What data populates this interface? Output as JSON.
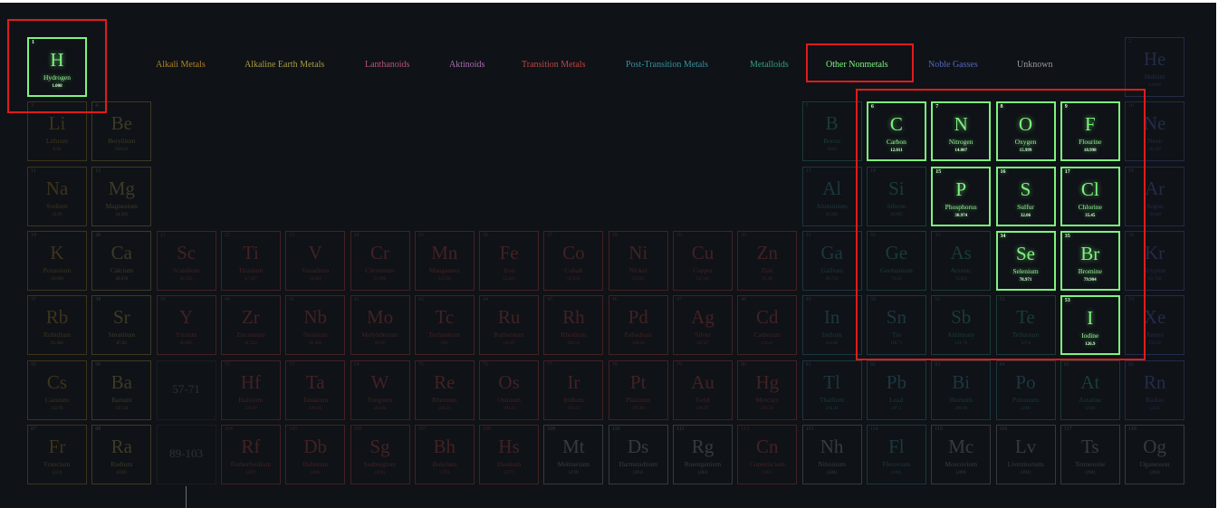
{
  "colors": {
    "background": "#0f1217",
    "highlight_red": "#e01b1b",
    "active_green": "#7ef37e",
    "categories": {
      "alkali": "#c9962a",
      "alkaline": "#c1b34b",
      "lanthanoid": "#d55d8e",
      "actinoid": "#c67ac8",
      "transition": "#d94f48",
      "post": "#3fa6b4",
      "metalloid": "#3ab79a",
      "nonmetal": "#7ef37e",
      "noble": "#5f78d8",
      "unknown": "#b0b0b0"
    }
  },
  "legend": [
    {
      "label": "Alkali Metals",
      "cat": "alkali"
    },
    {
      "label": "Alkaline Earth Metals",
      "cat": "alkaline"
    },
    {
      "label": "Lanthanoids",
      "cat": "lanthanoid"
    },
    {
      "label": "Aktinoids",
      "cat": "actinoid"
    },
    {
      "label": "Transition Metals",
      "cat": "transition"
    },
    {
      "label": "Post-Transition Metals",
      "cat": "post"
    },
    {
      "label": "Metalloids",
      "cat": "metalloid"
    },
    {
      "label": "Other Nonmetals",
      "cat": "nonmetal"
    },
    {
      "label": "Noble Gasses",
      "cat": "noble"
    },
    {
      "label": "Unknown",
      "cat": "unknown"
    }
  ],
  "active_legend": "Other Nonmetals",
  "placeholders": [
    {
      "label": "57-71",
      "period": 6,
      "group": 3
    },
    {
      "label": "89-103",
      "period": 7,
      "group": 3
    }
  ],
  "elements": [
    {
      "n": "1",
      "s": "H",
      "name": "Hydrogen",
      "mass": "1.008",
      "period": 1,
      "group": 1,
      "cat": "nonmetal",
      "lit": true
    },
    {
      "n": "2",
      "s": "He",
      "name": "Helium",
      "mass": "4.0026",
      "period": 1,
      "group": 18,
      "cat": "noble",
      "lit": false
    },
    {
      "n": "3",
      "s": "Li",
      "name": "Lithium",
      "mass": "6.94",
      "period": 2,
      "group": 1,
      "cat": "alkali",
      "lit": false
    },
    {
      "n": "4",
      "s": "Be",
      "name": "Beryllium",
      "mass": "9.0122",
      "period": 2,
      "group": 2,
      "cat": "alkaline",
      "lit": false
    },
    {
      "n": "5",
      "s": "B",
      "name": "Boron",
      "mass": "10.81",
      "period": 2,
      "group": 13,
      "cat": "metalloid",
      "lit": false
    },
    {
      "n": "6",
      "s": "C",
      "name": "Carbon",
      "mass": "12.011",
      "period": 2,
      "group": 14,
      "cat": "nonmetal",
      "lit": true
    },
    {
      "n": "7",
      "s": "N",
      "name": "Nitrogen",
      "mass": "14.007",
      "period": 2,
      "group": 15,
      "cat": "nonmetal",
      "lit": true
    },
    {
      "n": "8",
      "s": "O",
      "name": "Oxygen",
      "mass": "15.999",
      "period": 2,
      "group": 16,
      "cat": "nonmetal",
      "lit": true
    },
    {
      "n": "9",
      "s": "F",
      "name": "Flourine",
      "mass": "18.998",
      "period": 2,
      "group": 17,
      "cat": "nonmetal",
      "lit": true
    },
    {
      "n": "10",
      "s": "Ne",
      "name": "Neon",
      "mass": "20.180",
      "period": 2,
      "group": 18,
      "cat": "noble",
      "lit": false
    },
    {
      "n": "11",
      "s": "Na",
      "name": "Sodium",
      "mass": "22.99",
      "period": 3,
      "group": 1,
      "cat": "alkali",
      "lit": false
    },
    {
      "n": "12",
      "s": "Mg",
      "name": "Magnesium",
      "mass": "24.305",
      "period": 3,
      "group": 2,
      "cat": "alkaline",
      "lit": false
    },
    {
      "n": "13",
      "s": "Al",
      "name": "Aluminium",
      "mass": "26.982",
      "period": 3,
      "group": 13,
      "cat": "post",
      "lit": false
    },
    {
      "n": "14",
      "s": "Si",
      "name": "Silicon",
      "mass": "28.085",
      "period": 3,
      "group": 14,
      "cat": "metalloid",
      "lit": false
    },
    {
      "n": "15",
      "s": "P",
      "name": "Phosphorus",
      "mass": "30.974",
      "period": 3,
      "group": 15,
      "cat": "nonmetal",
      "lit": true
    },
    {
      "n": "16",
      "s": "S",
      "name": "Sulfur",
      "mass": "32.06",
      "period": 3,
      "group": 16,
      "cat": "nonmetal",
      "lit": true
    },
    {
      "n": "17",
      "s": "Cl",
      "name": "Chlorine",
      "mass": "35.45",
      "period": 3,
      "group": 17,
      "cat": "nonmetal",
      "lit": true
    },
    {
      "n": "18",
      "s": "Ar",
      "name": "Argon",
      "mass": "39.948",
      "period": 3,
      "group": 18,
      "cat": "noble",
      "lit": false
    },
    {
      "n": "19",
      "s": "K",
      "name": "Potassium",
      "mass": "39.098",
      "period": 4,
      "group": 1,
      "cat": "alkali",
      "lit": false
    },
    {
      "n": "20",
      "s": "Ca",
      "name": "Calcium",
      "mass": "40.078",
      "period": 4,
      "group": 2,
      "cat": "alkaline",
      "lit": false
    },
    {
      "n": "21",
      "s": "Sc",
      "name": "Scandium",
      "mass": "44.956",
      "period": 4,
      "group": 3,
      "cat": "transition",
      "lit": false
    },
    {
      "n": "22",
      "s": "Ti",
      "name": "Titanium",
      "mass": "47.867",
      "period": 4,
      "group": 4,
      "cat": "transition",
      "lit": false
    },
    {
      "n": "23",
      "s": "V",
      "name": "Vanadium",
      "mass": "50.942",
      "period": 4,
      "group": 5,
      "cat": "transition",
      "lit": false
    },
    {
      "n": "24",
      "s": "Cr",
      "name": "Chromium",
      "mass": "51.996",
      "period": 4,
      "group": 6,
      "cat": "transition",
      "lit": false
    },
    {
      "n": "25",
      "s": "Mn",
      "name": "Manganese",
      "mass": "54.938",
      "period": 4,
      "group": 7,
      "cat": "transition",
      "lit": false
    },
    {
      "n": "26",
      "s": "Fe",
      "name": "Iron",
      "mass": "55.845",
      "period": 4,
      "group": 8,
      "cat": "transition",
      "lit": false
    },
    {
      "n": "27",
      "s": "Co",
      "name": "Cobalt",
      "mass": "58.933",
      "period": 4,
      "group": 9,
      "cat": "transition",
      "lit": false
    },
    {
      "n": "28",
      "s": "Ni",
      "name": "Nickel",
      "mass": "58.693",
      "period": 4,
      "group": 10,
      "cat": "transition",
      "lit": false
    },
    {
      "n": "29",
      "s": "Cu",
      "name": "Copper",
      "mass": "63.546",
      "period": 4,
      "group": 11,
      "cat": "transition",
      "lit": false
    },
    {
      "n": "30",
      "s": "Zn",
      "name": "Zinc",
      "mass": "65.38",
      "period": 4,
      "group": 12,
      "cat": "transition",
      "lit": false
    },
    {
      "n": "31",
      "s": "Ga",
      "name": "Gallium",
      "mass": "69.723",
      "period": 4,
      "group": 13,
      "cat": "post",
      "lit": false
    },
    {
      "n": "32",
      "s": "Ge",
      "name": "Germanium",
      "mass": "72.63",
      "period": 4,
      "group": 14,
      "cat": "metalloid",
      "lit": false
    },
    {
      "n": "33",
      "s": "As",
      "name": "Arsenic",
      "mass": "74.922",
      "period": 4,
      "group": 15,
      "cat": "metalloid",
      "lit": false
    },
    {
      "n": "34",
      "s": "Se",
      "name": "Selenium",
      "mass": "78.971",
      "period": 4,
      "group": 16,
      "cat": "nonmetal",
      "lit": true
    },
    {
      "n": "35",
      "s": "Br",
      "name": "Bromine",
      "mass": "79.904",
      "period": 4,
      "group": 17,
      "cat": "nonmetal",
      "lit": true
    },
    {
      "n": "36",
      "s": "Kr",
      "name": "Krypton",
      "mass": "83.798",
      "period": 4,
      "group": 18,
      "cat": "noble",
      "lit": false
    },
    {
      "n": "37",
      "s": "Rb",
      "name": "Rubidium",
      "mass": "85.468",
      "period": 5,
      "group": 1,
      "cat": "alkali",
      "lit": false
    },
    {
      "n": "38",
      "s": "Sr",
      "name": "Strontium",
      "mass": "87.62",
      "period": 5,
      "group": 2,
      "cat": "alkaline",
      "lit": false
    },
    {
      "n": "39",
      "s": "Y",
      "name": "Yttrium",
      "mass": "88.906",
      "period": 5,
      "group": 3,
      "cat": "transition",
      "lit": false
    },
    {
      "n": "40",
      "s": "Zr",
      "name": "Zirconium",
      "mass": "91.224",
      "period": 5,
      "group": 4,
      "cat": "transition",
      "lit": false
    },
    {
      "n": "41",
      "s": "Nb",
      "name": "Niobium",
      "mass": "92.906",
      "period": 5,
      "group": 5,
      "cat": "transition",
      "lit": false
    },
    {
      "n": "42",
      "s": "Mo",
      "name": "Molybdenum",
      "mass": "95.95",
      "period": 5,
      "group": 6,
      "cat": "transition",
      "lit": false
    },
    {
      "n": "43",
      "s": "Tc",
      "name": "Technetium",
      "mass": "(98)",
      "period": 5,
      "group": 7,
      "cat": "transition",
      "lit": false
    },
    {
      "n": "44",
      "s": "Ru",
      "name": "Ruthenium",
      "mass": "101.07",
      "period": 5,
      "group": 8,
      "cat": "transition",
      "lit": false
    },
    {
      "n": "45",
      "s": "Rh",
      "name": "Rhodium",
      "mass": "102.91",
      "period": 5,
      "group": 9,
      "cat": "transition",
      "lit": false
    },
    {
      "n": "46",
      "s": "Pd",
      "name": "Palladium",
      "mass": "106.42",
      "period": 5,
      "group": 10,
      "cat": "transition",
      "lit": false
    },
    {
      "n": "47",
      "s": "Ag",
      "name": "Silver",
      "mass": "107.87",
      "period": 5,
      "group": 11,
      "cat": "transition",
      "lit": false
    },
    {
      "n": "48",
      "s": "Cd",
      "name": "Cadmium",
      "mass": "112.41",
      "period": 5,
      "group": 12,
      "cat": "transition",
      "lit": false
    },
    {
      "n": "49",
      "s": "In",
      "name": "Indium",
      "mass": "114.82",
      "period": 5,
      "group": 13,
      "cat": "post",
      "lit": false
    },
    {
      "n": "50",
      "s": "Sn",
      "name": "Tin",
      "mass": "118.71",
      "period": 5,
      "group": 14,
      "cat": "post",
      "lit": false
    },
    {
      "n": "51",
      "s": "Sb",
      "name": "Antimony",
      "mass": "121.76",
      "period": 5,
      "group": 15,
      "cat": "metalloid",
      "lit": false
    },
    {
      "n": "52",
      "s": "Te",
      "name": "Tellurium",
      "mass": "127.6",
      "period": 5,
      "group": 16,
      "cat": "metalloid",
      "lit": false
    },
    {
      "n": "53",
      "s": "I",
      "name": "Iodine",
      "mass": "126.9",
      "period": 5,
      "group": 17,
      "cat": "nonmetal",
      "lit": true
    },
    {
      "n": "54",
      "s": "Xe",
      "name": "Xenon",
      "mass": "131.29",
      "period": 5,
      "group": 18,
      "cat": "noble",
      "lit": false
    },
    {
      "n": "55",
      "s": "Cs",
      "name": "Caesium",
      "mass": "132.91",
      "period": 6,
      "group": 1,
      "cat": "alkali",
      "lit": false
    },
    {
      "n": "56",
      "s": "Ba",
      "name": "Barium",
      "mass": "137.33",
      "period": 6,
      "group": 2,
      "cat": "alkaline",
      "lit": false
    },
    {
      "n": "72",
      "s": "Hf",
      "name": "Hafnium",
      "mass": "178.49",
      "period": 6,
      "group": 4,
      "cat": "transition",
      "lit": false
    },
    {
      "n": "73",
      "s": "Ta",
      "name": "Tantalum",
      "mass": "180.95",
      "period": 6,
      "group": 5,
      "cat": "transition",
      "lit": false
    },
    {
      "n": "74",
      "s": "W",
      "name": "Tungsten",
      "mass": "183.84",
      "period": 6,
      "group": 6,
      "cat": "transition",
      "lit": false
    },
    {
      "n": "75",
      "s": "Re",
      "name": "Rhenium",
      "mass": "186.21",
      "period": 6,
      "group": 7,
      "cat": "transition",
      "lit": false
    },
    {
      "n": "76",
      "s": "Os",
      "name": "Osmium",
      "mass": "190.23",
      "period": 6,
      "group": 8,
      "cat": "transition",
      "lit": false
    },
    {
      "n": "77",
      "s": "Ir",
      "name": "Iridium",
      "mass": "192.22",
      "period": 6,
      "group": 9,
      "cat": "transition",
      "lit": false
    },
    {
      "n": "78",
      "s": "Pt",
      "name": "Platinum",
      "mass": "195.08",
      "period": 6,
      "group": 10,
      "cat": "transition",
      "lit": false
    },
    {
      "n": "79",
      "s": "Au",
      "name": "Gold",
      "mass": "196.97",
      "period": 6,
      "group": 11,
      "cat": "transition",
      "lit": false
    },
    {
      "n": "80",
      "s": "Hg",
      "name": "Mercury",
      "mass": "200.59",
      "period": 6,
      "group": 12,
      "cat": "transition",
      "lit": false
    },
    {
      "n": "81",
      "s": "Tl",
      "name": "Thallium",
      "mass": "204.38",
      "period": 6,
      "group": 13,
      "cat": "post",
      "lit": false
    },
    {
      "n": "82",
      "s": "Pb",
      "name": "Lead",
      "mass": "207.2",
      "period": 6,
      "group": 14,
      "cat": "post",
      "lit": false
    },
    {
      "n": "83",
      "s": "Bi",
      "name": "Bismuth",
      "mass": "208.98",
      "period": 6,
      "group": 15,
      "cat": "post",
      "lit": false
    },
    {
      "n": "84",
      "s": "Po",
      "name": "Polonium",
      "mass": "(209)",
      "period": 6,
      "group": 16,
      "cat": "post",
      "lit": false
    },
    {
      "n": "85",
      "s": "At",
      "name": "Astatine",
      "mass": "(210)",
      "period": 6,
      "group": 17,
      "cat": "metalloid",
      "lit": false
    },
    {
      "n": "86",
      "s": "Rn",
      "name": "Radon",
      "mass": "(222)",
      "period": 6,
      "group": 18,
      "cat": "noble",
      "lit": false
    },
    {
      "n": "87",
      "s": "Fr",
      "name": "Francium",
      "mass": "(223)",
      "period": 7,
      "group": 1,
      "cat": "alkali",
      "lit": false
    },
    {
      "n": "88",
      "s": "Ra",
      "name": "Radium",
      "mass": "(226)",
      "period": 7,
      "group": 2,
      "cat": "alkaline",
      "lit": false
    },
    {
      "n": "104",
      "s": "Rf",
      "name": "Rutherfordium",
      "mass": "(267)",
      "period": 7,
      "group": 4,
      "cat": "transition",
      "lit": false
    },
    {
      "n": "105",
      "s": "Db",
      "name": "Dubnium",
      "mass": "(268)",
      "period": 7,
      "group": 5,
      "cat": "transition",
      "lit": false
    },
    {
      "n": "106",
      "s": "Sg",
      "name": "Seaborgium",
      "mass": "(269)",
      "period": 7,
      "group": 6,
      "cat": "transition",
      "lit": false
    },
    {
      "n": "107",
      "s": "Bh",
      "name": "Bohrium",
      "mass": "(270)",
      "period": 7,
      "group": 7,
      "cat": "transition",
      "lit": false
    },
    {
      "n": "108",
      "s": "Hs",
      "name": "Hassium",
      "mass": "(277)",
      "period": 7,
      "group": 8,
      "cat": "transition",
      "lit": false
    },
    {
      "n": "109",
      "s": "Mt",
      "name": "Meitnerium",
      "mass": "(278)",
      "period": 7,
      "group": 9,
      "cat": "unknown",
      "lit": false
    },
    {
      "n": "110",
      "s": "Ds",
      "name": "Darmstadtium",
      "mass": "(281)",
      "period": 7,
      "group": 10,
      "cat": "unknown",
      "lit": false
    },
    {
      "n": "111",
      "s": "Rg",
      "name": "Roentgenium",
      "mass": "(282)",
      "period": 7,
      "group": 11,
      "cat": "unknown",
      "lit": false
    },
    {
      "n": "112",
      "s": "Cn",
      "name": "Copernicium",
      "mass": "(285)",
      "period": 7,
      "group": 12,
      "cat": "transition",
      "lit": false
    },
    {
      "n": "113",
      "s": "Nh",
      "name": "Nihonium",
      "mass": "(286)",
      "period": 7,
      "group": 13,
      "cat": "unknown",
      "lit": false
    },
    {
      "n": "114",
      "s": "Fl",
      "name": "Flerovium",
      "mass": "(289)",
      "period": 7,
      "group": 14,
      "cat": "post",
      "lit": false
    },
    {
      "n": "115",
      "s": "Mc",
      "name": "Moscovium",
      "mass": "(290)",
      "period": 7,
      "group": 15,
      "cat": "unknown",
      "lit": false
    },
    {
      "n": "116",
      "s": "Lv",
      "name": "Livermorium",
      "mass": "(293)",
      "period": 7,
      "group": 16,
      "cat": "unknown",
      "lit": false
    },
    {
      "n": "117",
      "s": "Ts",
      "name": "Tennessine",
      "mass": "(294)",
      "period": 7,
      "group": 17,
      "cat": "unknown",
      "lit": false
    },
    {
      "n": "118",
      "s": "Og",
      "name": "Oganesson",
      "mass": "(294)",
      "period": 7,
      "group": 18,
      "cat": "unknown",
      "lit": false
    }
  ]
}
